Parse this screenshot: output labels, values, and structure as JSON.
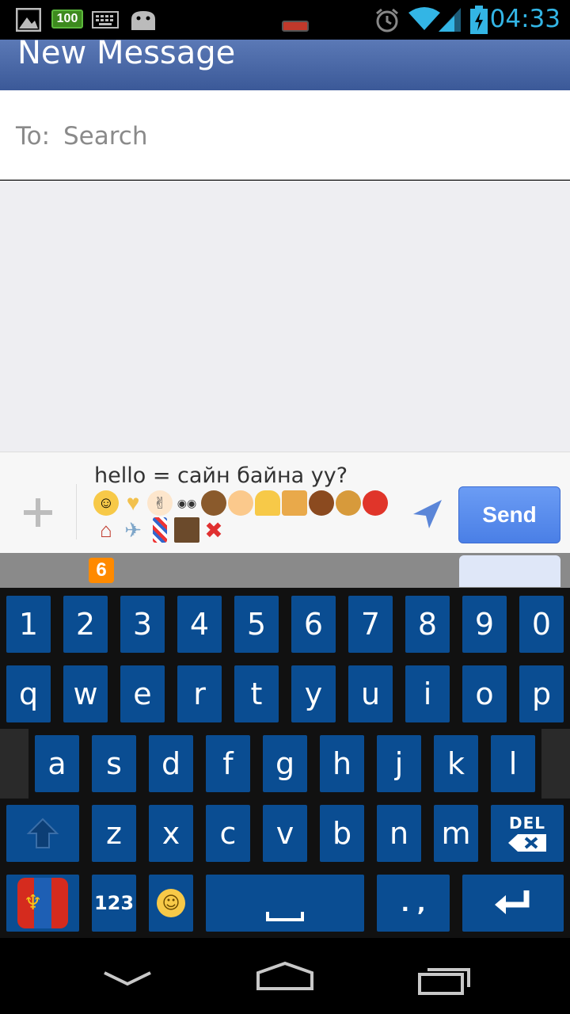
{
  "status_bar": {
    "battery_level_icon_text": "100",
    "time": "04:33"
  },
  "app_bar": {
    "title": "New Message"
  },
  "recipient": {
    "label": "To:",
    "placeholder": "Search"
  },
  "compose": {
    "message_text": "hello = сайн байна уу?",
    "emoji_row_1": [
      "grinning-face",
      "yellow-heart",
      "victory-hand",
      "eyes",
      "horse-face",
      "baby-chick",
      "bell",
      "megaphone",
      "american-football",
      "hamburger",
      "tomato"
    ],
    "emoji_row_2": [
      "house",
      "airplane",
      "barber-pole",
      "film-frames",
      "cross-mark"
    ],
    "send_label": "Send"
  },
  "ghost_badge": "6",
  "keyboard": {
    "row_numbers": [
      "1",
      "2",
      "3",
      "4",
      "5",
      "6",
      "7",
      "8",
      "9",
      "0"
    ],
    "row_top": [
      "q",
      "w",
      "e",
      "r",
      "t",
      "y",
      "u",
      "i",
      "o",
      "p"
    ],
    "row_middle": [
      "a",
      "s",
      "d",
      "f",
      "g",
      "h",
      "j",
      "k",
      "l"
    ],
    "row_bottom": [
      "z",
      "x",
      "c",
      "v",
      "b",
      "n",
      "m"
    ],
    "del_label": "DEL",
    "numbers_label": "123",
    "punct_label": ". ,"
  },
  "colors": {
    "app_bar": "#3b5998",
    "key": "#0a4d92",
    "send_button": "#4a7fe6",
    "status_time": "#33b5e5"
  }
}
